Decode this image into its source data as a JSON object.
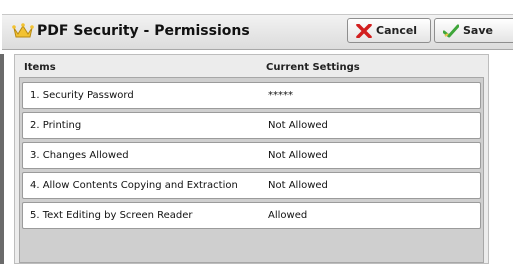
{
  "header": {
    "title": "PDF Security - Permissions",
    "cancel_label": "Cancel",
    "save_label": "Save"
  },
  "columns": {
    "items": "Items",
    "current_settings": "Current Settings"
  },
  "rows": [
    {
      "item": "1. Security Password",
      "value": "*****"
    },
    {
      "item": "2. Printing",
      "value": "Not Allowed"
    },
    {
      "item": "3. Changes Allowed",
      "value": "Not Allowed"
    },
    {
      "item": "4. Allow Contents Copying and Extraction",
      "value": "Not Allowed"
    },
    {
      "item": "5. Text Editing by Screen Reader",
      "value": "Allowed"
    }
  ],
  "icons": {
    "title_icon": "crown-icon",
    "cancel_icon": "red-x-icon",
    "save_icon": "green-check-icon"
  },
  "colors": {
    "crown": "#f2c232",
    "cancel_x": "#d21f1f",
    "save_check": "#3fa63a"
  }
}
